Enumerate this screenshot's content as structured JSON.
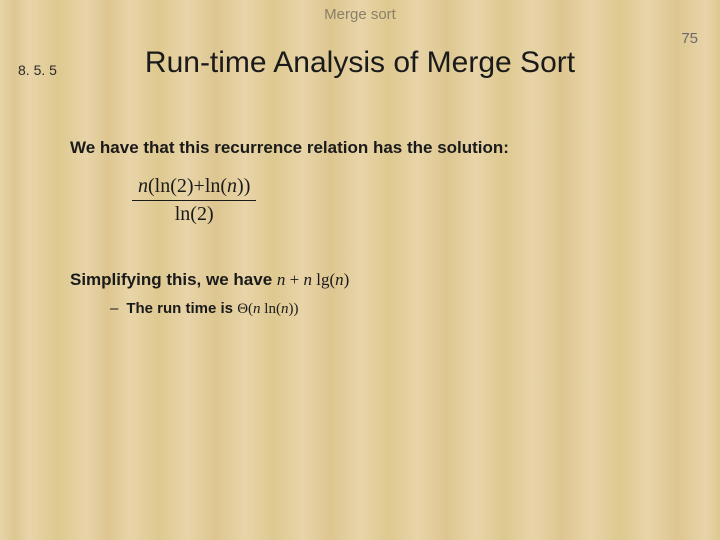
{
  "header": {
    "topic": "Merge sort",
    "page_number": "75"
  },
  "section": {
    "number": "8. 5. 5",
    "title": "Run-time Analysis of Merge Sort"
  },
  "body": {
    "intro": "We have that this recurrence relation has the solution:",
    "formula": {
      "numerator_a": "n",
      "numerator_b": "(ln(2)+ln(",
      "numerator_c": "n",
      "numerator_d": "))",
      "denominator": "ln(2)"
    },
    "simplify_prefix": "Simplifying this, we have ",
    "simplify_expr_a": "n",
    "simplify_expr_b": " + ",
    "simplify_expr_c": "n",
    "simplify_expr_d": " lg(",
    "simplify_expr_e": "n",
    "simplify_expr_f": ")",
    "bullet": {
      "dash": "–",
      "text_a": "The run time is ",
      "theta": "Θ(",
      "text_b": "n",
      "text_c": " ln(",
      "text_d": "n",
      "text_e": "))"
    }
  }
}
